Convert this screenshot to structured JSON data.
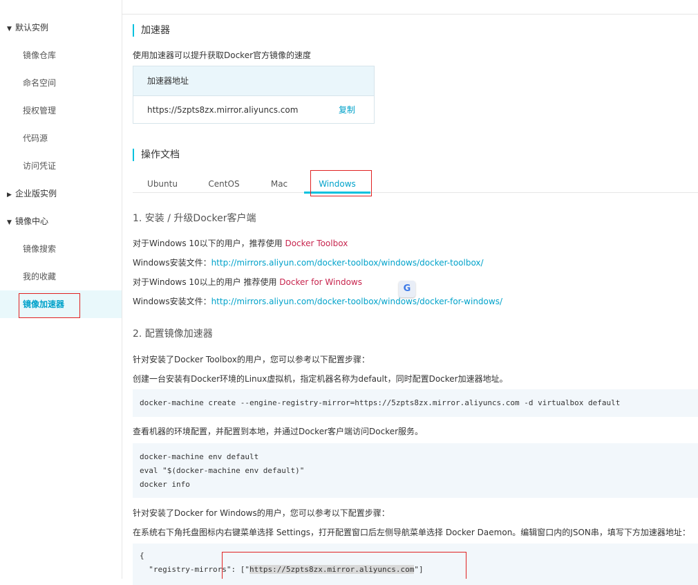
{
  "sidebar": {
    "groups": [
      {
        "label": "默认实例",
        "expanded": true
      },
      {
        "label": "企业版实例",
        "expanded": false
      },
      {
        "label": "镜像中心",
        "expanded": true
      }
    ],
    "items": [
      {
        "label": "镜像仓库"
      },
      {
        "label": "命名空间"
      },
      {
        "label": "授权管理"
      },
      {
        "label": "代码源"
      },
      {
        "label": "访问凭证"
      },
      {
        "label": "镜像搜索"
      },
      {
        "label": "我的收藏"
      },
      {
        "label": "镜像加速器",
        "active": true
      }
    ]
  },
  "accelerator": {
    "title": "加速器",
    "description": "使用加速器可以提升获取Docker官方镜像的速度",
    "table_header": "加速器地址",
    "address": "https://5zpts8zx.mirror.aliyuncs.com",
    "copy_label": "复制"
  },
  "docs": {
    "title": "操作文档",
    "tabs": [
      "Ubuntu",
      "CentOS",
      "Mac",
      "Windows"
    ],
    "active_tab": "Windows",
    "step1_title": "1. 安装 / 升级Docker客户端",
    "line1_prefix": "对于Windows 10以下的用户，推荐使用 ",
    "line1_link": "Docker Toolbox",
    "line2_prefix": "Windows安装文件：",
    "line2_link": "http://mirrors.aliyun.com/docker-toolbox/windows/docker-toolbox/",
    "line3_prefix": "对于Windows 10以上的用户 推荐使用 ",
    "line3_link": "Docker for Windows",
    "line4_prefix": "Windows安装文件：",
    "line4_link": "http://mirrors.aliyun.com/docker-toolbox/windows/docker-for-windows/",
    "step2_title": "2. 配置镜像加速器",
    "toolbox_intro": "针对安装了Docker Toolbox的用户，您可以参考以下配置步骤：",
    "toolbox_step1": "创建一台安装有Docker环境的Linux虚拟机，指定机器名称为default，同时配置Docker加速器地址。",
    "code1": "docker-machine create --engine-registry-mirror=https://5zpts8zx.mirror.aliyuncs.com -d virtualbox default",
    "toolbox_step2": "查看机器的环境配置，并配置到本地，并通过Docker客户端访问Docker服务。",
    "code2_l1": "docker-machine env default",
    "code2_l2": "eval \"$(docker-machine env default)\"",
    "code2_l3": "docker info",
    "dfw_intro": "针对安装了Docker for Windows的用户，您可以参考以下配置步骤：",
    "dfw_step": "在系统右下角托盘图标内右键菜单选择 Settings，打开配置窗口后左侧导航菜单选择 Docker Daemon。编辑窗口内的JSON串，填写下方加速器地址：",
    "code3_l1": "{",
    "code3_key": "  \"registry-mirrors\": [\"",
    "code3_url": "https://5zpts8zx.mirror.aliyuncs.com",
    "code3_end": "\"]"
  },
  "translate_icon": "google-translate-icon",
  "colors": {
    "accent": "#00c1de",
    "link": "#00a2ca",
    "highlight_link": "#c7254e",
    "annotation": "#e02020"
  }
}
